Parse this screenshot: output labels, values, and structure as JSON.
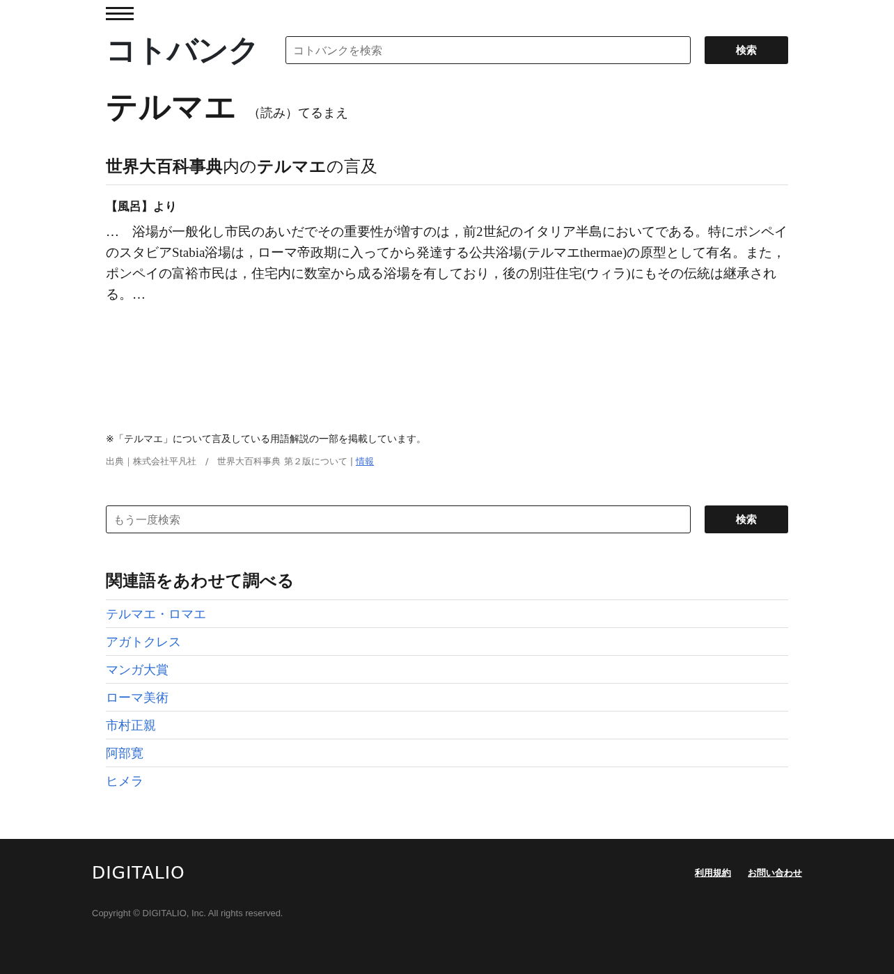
{
  "header": {
    "logo": "コトバンク",
    "search": {
      "placeholder": "コトバンクを検索"
    },
    "search_button": "検索"
  },
  "entry": {
    "title": "テルマエ",
    "reading": "（読み）てるまえ"
  },
  "mention": {
    "heading": "**世界大百科事典**内の**テルマエ**の言及",
    "source_entry": "【風呂】より",
    "excerpt": "…　浴場が一般化し市民のあいだでその重要性が増すのは，前2世紀のイタリア半島においてである。特にポンペイのスタビアStabia浴場は，ローマ帝政期に入ってから発達する公共浴場(テルマエthermae)の原型として有名。また，ポンペイの富裕市民は，住宅内に数室から成る浴場を有しており，後の別荘住宅(ウィラ)にもその伝統は継承される。…",
    "note": "※「テルマエ」について言及している用語解説の一部を掲載しています。",
    "credit": "出典｜株式会社平凡社　/　世界大百科事典 第２版について |",
    "credit_link": "情報"
  },
  "search_again": {
    "placeholder": "もう一度検索",
    "button": "検索"
  },
  "related": {
    "heading": "関連語をあわせて調べる",
    "items": [
      "テルマエ・ロマエ",
      "アガトクレス",
      "マンガ大賞",
      "ローマ美術",
      "市村正親",
      "阿部寛",
      "ヒメラ"
    ]
  },
  "footer": {
    "logo": "DIGITALIO",
    "links": [
      "利用規約",
      "お問い合わせ"
    ],
    "copyright": "Copyright © DIGITALIO, Inc. All rights reserved."
  }
}
